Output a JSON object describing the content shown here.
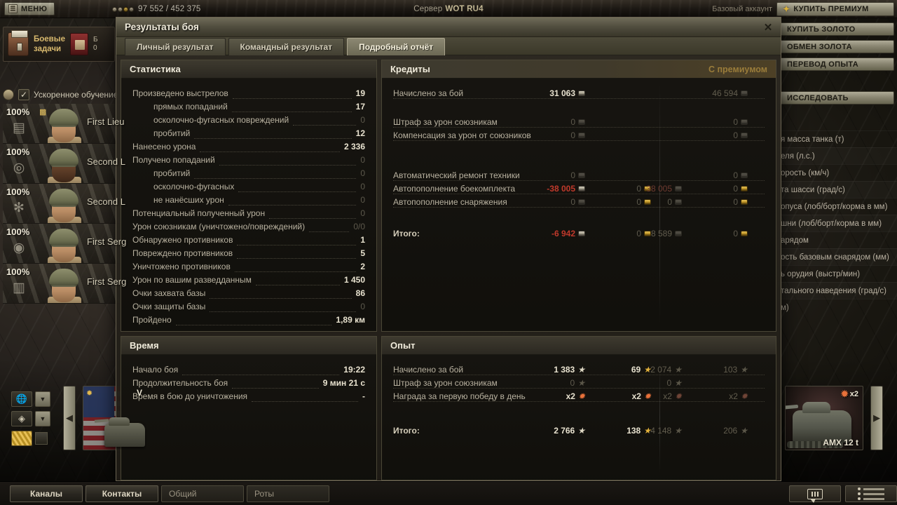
{
  "topbar": {
    "menu_label": "МЕНЮ",
    "credits_value": "97 552 / 452 375",
    "server_prefix": "Сервер",
    "server_name": "WOT RU4",
    "account_label": "Базовый аккаунт",
    "premium_button": "КУПИТЬ ПРЕМИУМ"
  },
  "left": {
    "tasks_label_line1": "Боевые",
    "tasks_label_line2": "задачи",
    "book_line1": "Б",
    "book_line2": "0",
    "accelerated_training": "Ускоренное обучение э",
    "crew": [
      {
        "percent": "100%",
        "rank": "First Lieu",
        "skill_icon": "binoculars-icon"
      },
      {
        "percent": "100%",
        "rank": "Second L",
        "skill_icon": "sight-icon"
      },
      {
        "percent": "100%",
        "rank": "Second L",
        "skill_icon": "gear-icon"
      },
      {
        "percent": "100%",
        "rank": "First Serg",
        "skill_icon": "radio-icon"
      },
      {
        "percent": "100%",
        "rank": "First Serg",
        "skill_icon": "ammo-icon"
      }
    ],
    "tools": {
      "nation_filter_icon": "globe-icon",
      "type_filter_icon": "vehicle-type-icon",
      "gold_icon": "gold-stripes-icon",
      "checkbox_icon": "checkbox-icon"
    },
    "tank_card": {
      "tier": "V",
      "emblem": "ace-emblem-icon"
    }
  },
  "right": {
    "buttons": [
      "КУПИТЬ ЗОЛОТО",
      "ОБМЕН ЗОЛОТА",
      "ПЕРЕВОД ОПЫТА",
      "ИССЛЕДОВАТЬ"
    ],
    "specs": [
      "я масса танка (т)",
      "еля (л.с.)",
      "орость (км/ч)",
      "та шасси (град/с)",
      "опуса (лоб/борт/корма в мм)",
      "шни (лоб/борт/корма в мм)",
      "арядом",
      "ость базовым снарядом (мм)",
      "ь орудия (выстр/мин)",
      "тального наведения (град/с)",
      "м)"
    ],
    "tank_card": {
      "name": "AMX 12 t",
      "bonus": "x2"
    }
  },
  "bottombar": {
    "channels": "Каналы",
    "contacts": "Контакты",
    "tab_general": "Общий",
    "tab_companies": "Роты",
    "chat_icon": "chat-icon",
    "list_icon": "list-icon"
  },
  "dialog": {
    "title": "Результаты боя",
    "close_icon": "close-icon",
    "tabs": [
      {
        "label": "Личный результат",
        "active": false
      },
      {
        "label": "Командный результат",
        "active": false
      },
      {
        "label": "Подробный отчёт",
        "active": true
      }
    ]
  },
  "statistics": {
    "title": "Статистика",
    "rows": [
      {
        "label": "Произведено выстрелов",
        "value": "19",
        "indent": 0,
        "zero": false
      },
      {
        "label": "прямых попаданий",
        "value": "17",
        "indent": 1,
        "zero": false
      },
      {
        "label": "осколочно-фугасных повреждений",
        "value": "0",
        "indent": 1,
        "zero": true
      },
      {
        "label": "пробитий",
        "value": "12",
        "indent": 1,
        "zero": false
      },
      {
        "label": "Нанесено урона",
        "value": "2 336",
        "indent": 0,
        "zero": false
      },
      {
        "label": "Получено попаданий",
        "value": "0",
        "indent": 0,
        "zero": true
      },
      {
        "label": "пробитий",
        "value": "0",
        "indent": 1,
        "zero": true
      },
      {
        "label": "осколочно-фугасных",
        "value": "0",
        "indent": 1,
        "zero": true
      },
      {
        "label": "не нанёсших урон",
        "value": "0",
        "indent": 1,
        "zero": true
      },
      {
        "label": "Потенциальный полученный урон",
        "value": "0",
        "indent": 0,
        "zero": true
      },
      {
        "label": "Урон союзникам (уничтожено/повреждений)",
        "value": "0/0",
        "indent": 0,
        "zero": true
      },
      {
        "label": "Обнаружено противников",
        "value": "1",
        "indent": 0,
        "zero": false
      },
      {
        "label": "Повреждено противников",
        "value": "5",
        "indent": 0,
        "zero": false
      },
      {
        "label": "Уничтожено противников",
        "value": "2",
        "indent": 0,
        "zero": false
      },
      {
        "label": "Урон по вашим разведданным",
        "value": "1 450",
        "indent": 0,
        "zero": false
      },
      {
        "label": "Очки захвата базы",
        "value": "86",
        "indent": 0,
        "zero": false
      },
      {
        "label": "Очки защиты базы",
        "value": "0",
        "indent": 0,
        "zero": true
      },
      {
        "label": "Пройдено",
        "value": "1,89 км",
        "indent": 0,
        "zero": false
      }
    ]
  },
  "credits": {
    "title": "Кредиты",
    "premium_header": "С премиумом",
    "rows": [
      {
        "label": "Начислено за бой",
        "silver": "31 063",
        "silver_state": "normal",
        "gold": "",
        "gold_state": "none",
        "p_silver": "46 594",
        "p_silver_state": "dim",
        "p_gold": "",
        "p_gold_state": "none",
        "spacer_after": true
      },
      {
        "label": "Штраф за урон союзникам",
        "silver": "0",
        "silver_state": "zero",
        "gold": "",
        "gold_state": "none",
        "p_silver": "0",
        "p_silver_state": "zero",
        "p_gold": "",
        "p_gold_state": "none",
        "spacer_after": false
      },
      {
        "label": "Компенсация за урон от союзников",
        "silver": "0",
        "silver_state": "zero",
        "gold": "",
        "gold_state": "none",
        "p_silver": "0",
        "p_silver_state": "zero",
        "p_gold": "",
        "p_gold_state": "none",
        "spacer_after": true
      },
      {
        "label": "Автоматический ремонт техники",
        "silver": "0",
        "silver_state": "zero",
        "gold": "",
        "gold_state": "none",
        "p_silver": "0",
        "p_silver_state": "zero",
        "p_gold": "",
        "p_gold_state": "none",
        "spacer_after": false
      },
      {
        "label": "Автопополнение боекомплекта",
        "silver": "-38 005",
        "silver_state": "neg",
        "gold": "0",
        "gold_state": "zero",
        "p_silver": "-38 005",
        "p_silver_state": "negdim",
        "p_gold": "0",
        "p_gold_state": "zero",
        "spacer_after": false
      },
      {
        "label": "Автопополнение снаряжения",
        "silver": "0",
        "silver_state": "zero",
        "gold": "0",
        "gold_state": "zero",
        "p_silver": "0",
        "p_silver_state": "zero",
        "p_gold": "0",
        "p_gold_state": "zero",
        "spacer_after": false
      }
    ],
    "total": {
      "label": "Итого:",
      "silver": "-6 942",
      "silver_state": "neg",
      "gold": "0",
      "gold_state": "zero",
      "p_silver": "8 589",
      "p_silver_state": "dim",
      "p_gold": "0",
      "p_gold_state": "zero"
    }
  },
  "time": {
    "title": "Время",
    "rows": [
      {
        "label": "Начало боя",
        "value": "19:22"
      },
      {
        "label": "Продолжительность боя",
        "value": "9 мин 21 с"
      },
      {
        "label": "Время в бою до уничтожения",
        "value": "-"
      }
    ]
  },
  "experience": {
    "title": "Опыт",
    "rows": [
      {
        "label": "Начислено за бой",
        "xp": "1 383",
        "xp_state": "normal",
        "free": "69",
        "free_state": "gold",
        "p_xp": "2 074",
        "p_xp_state": "dim",
        "p_free": "103",
        "p_free_state": "golddim"
      },
      {
        "label": "Штраф за урон союзникам",
        "xp": "0",
        "xp_state": "zero",
        "free": "",
        "free_state": "none",
        "p_xp": "0",
        "p_xp_state": "zero",
        "p_free": "",
        "p_free_state": "none"
      },
      {
        "label": "Награда за первую победу в день",
        "xp": "x2",
        "xp_state": "orange",
        "free": "x2",
        "free_state": "orange",
        "p_xp": "x2",
        "p_xp_state": "orangedim",
        "p_free": "x2",
        "p_free_state": "orangedim"
      }
    ],
    "total": {
      "label": "Итого:",
      "xp": "2 766",
      "xp_state": "normal",
      "free": "138",
      "free_state": "gold",
      "p_xp": "4 148",
      "p_xp_state": "dim",
      "p_free": "206",
      "p_free_state": "golddim"
    }
  }
}
